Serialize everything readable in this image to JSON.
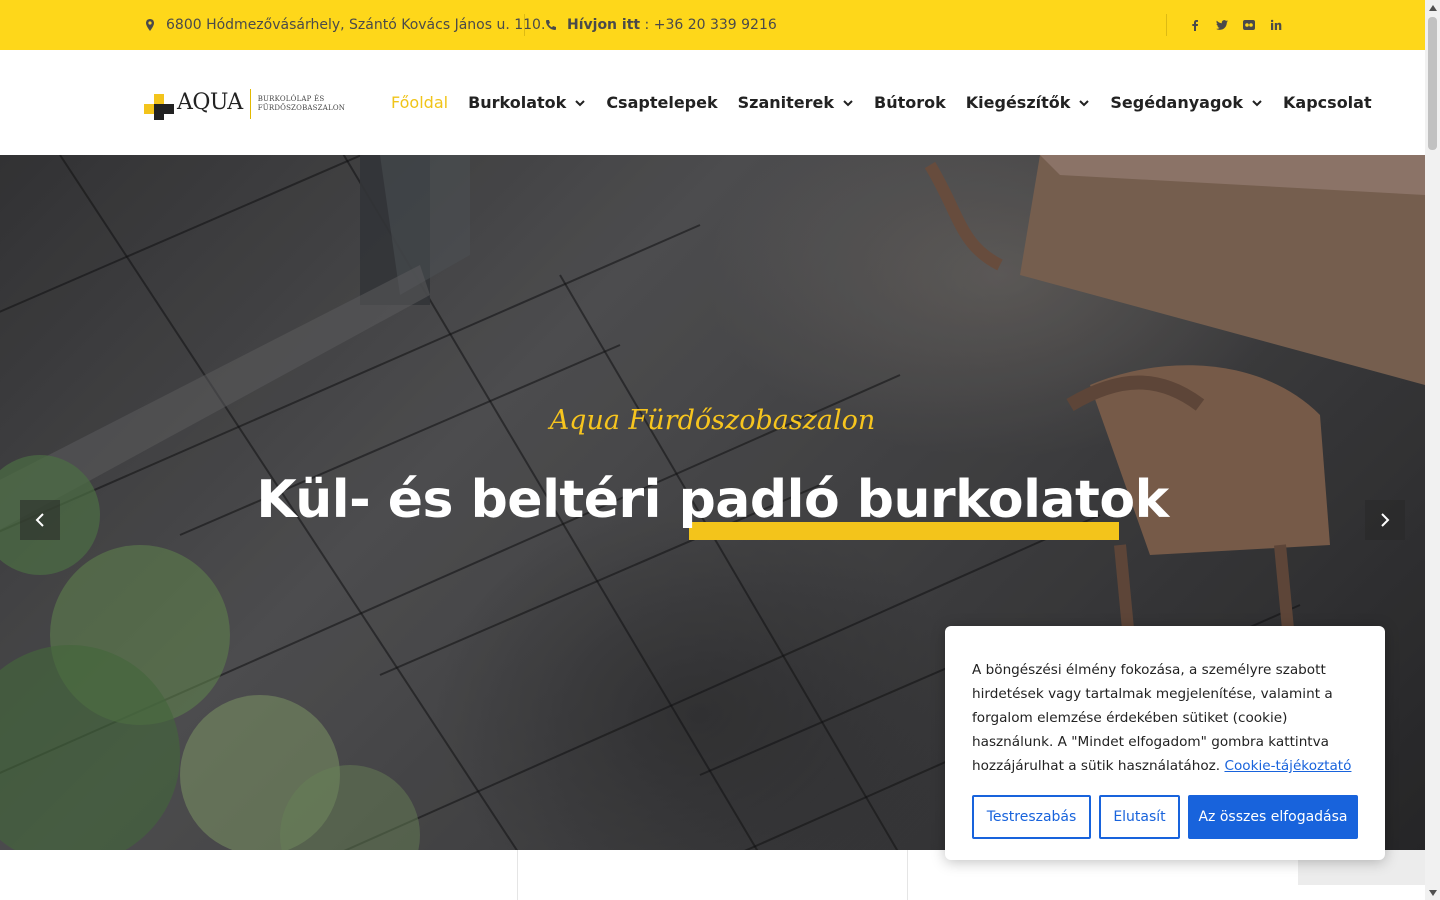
{
  "topbar": {
    "address": "6800 Hódmezővásárhely, Szántó Kovács János u. 110.",
    "phone_label": "Hívjon itt",
    "phone_number": " : +36 20 339 9216",
    "social": [
      "facebook-icon",
      "twitter-icon",
      "flickr-icon",
      "linkedin-icon"
    ],
    "bg_color": "#fed71a"
  },
  "header": {
    "logo_word": "AQUA",
    "logo_sub_line1": "BURKOLÓLAP ÉS",
    "logo_sub_line2": "FÜRDŐSZOBASZALON",
    "nav": [
      {
        "label": "Főoldal",
        "active": true,
        "dropdown": false
      },
      {
        "label": "Burkolatok",
        "active": false,
        "dropdown": true
      },
      {
        "label": "Csaptelepek",
        "active": false,
        "dropdown": false
      },
      {
        "label": "Szaniterek",
        "active": false,
        "dropdown": true
      },
      {
        "label": "Bútorok",
        "active": false,
        "dropdown": false
      },
      {
        "label": "Kiegészítők",
        "active": false,
        "dropdown": true
      },
      {
        "label": "Segédanyagok",
        "active": false,
        "dropdown": true
      },
      {
        "label": "Kapcsolat",
        "active": false,
        "dropdown": false
      }
    ]
  },
  "hero": {
    "subtitle": "Aqua Fürdőszobaszalon",
    "title": "Kül- és beltéri padló burkolatok",
    "accent_color": "#f3c41b"
  },
  "cookie": {
    "text": "A böngészési élmény fokozása, a személyre szabott hirdetések vagy tartalmak megjelenítése, valamint a forgalom elemzése érdekében sütiket (cookie) használunk. A \"Mindet elfogadom\" gombra kattintva hozzájárulhat a sütik használatához.",
    "link": "Cookie-tájékoztató",
    "btn_customize": "Testreszabás",
    "btn_reject": "Elutasít",
    "btn_accept": "Az összes elfogadása",
    "accent_color": "#1863dc"
  }
}
